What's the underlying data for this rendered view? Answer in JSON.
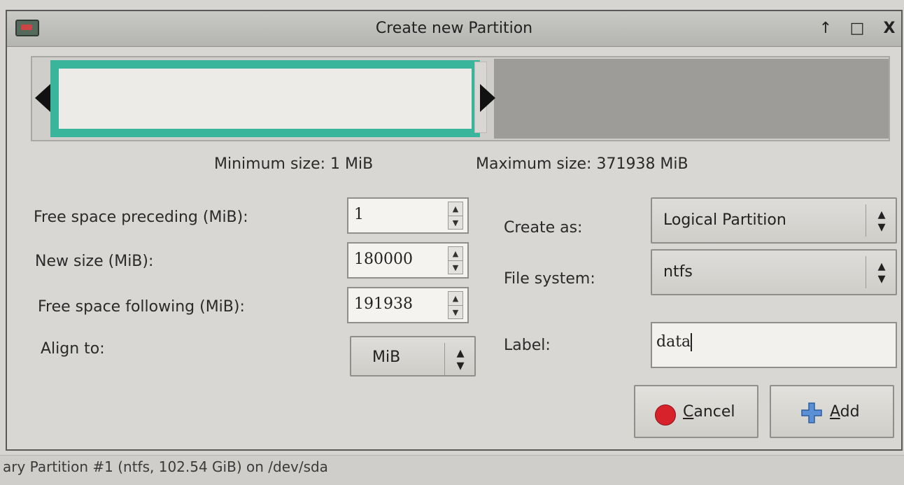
{
  "background": {
    "status_text": "ary Partition #1 (ntfs, 102.54 GiB) on /dev/sda"
  },
  "dialog": {
    "title": "Create new Partition",
    "titlebar_buttons": {
      "up": "↑",
      "maximize": "□",
      "close": "X"
    }
  },
  "sizes": {
    "min_label": "Minimum size: 1 MiB",
    "max_label": "Maximum size: 371938 MiB"
  },
  "form": {
    "preceding_label": "Free space preceding (MiB):",
    "preceding_value": "1",
    "newsize_label": "New size (MiB):",
    "newsize_value": "180000",
    "following_label": "Free space following (MiB):",
    "following_value": "191938",
    "align_label": "Align to:",
    "align_value": "MiB",
    "createas_label": "Create as:",
    "createas_value": "Logical Partition",
    "fs_label": "File system:",
    "fs_value": "ntfs",
    "label_label": "Label:",
    "label_value": "data"
  },
  "buttons": {
    "cancel_mnemonic": "C",
    "cancel_rest": "ancel",
    "add_mnemonic": "A",
    "add_rest": "dd"
  },
  "colors": {
    "partition_border": "#38b59a",
    "unallocated": "#9d9c99",
    "cancel_icon": "#d8222b",
    "add_icon": "#5b8fd6"
  },
  "icons": {
    "app": "gparted-icon",
    "cancel": "cancel-icon",
    "add": "plus-icon"
  }
}
